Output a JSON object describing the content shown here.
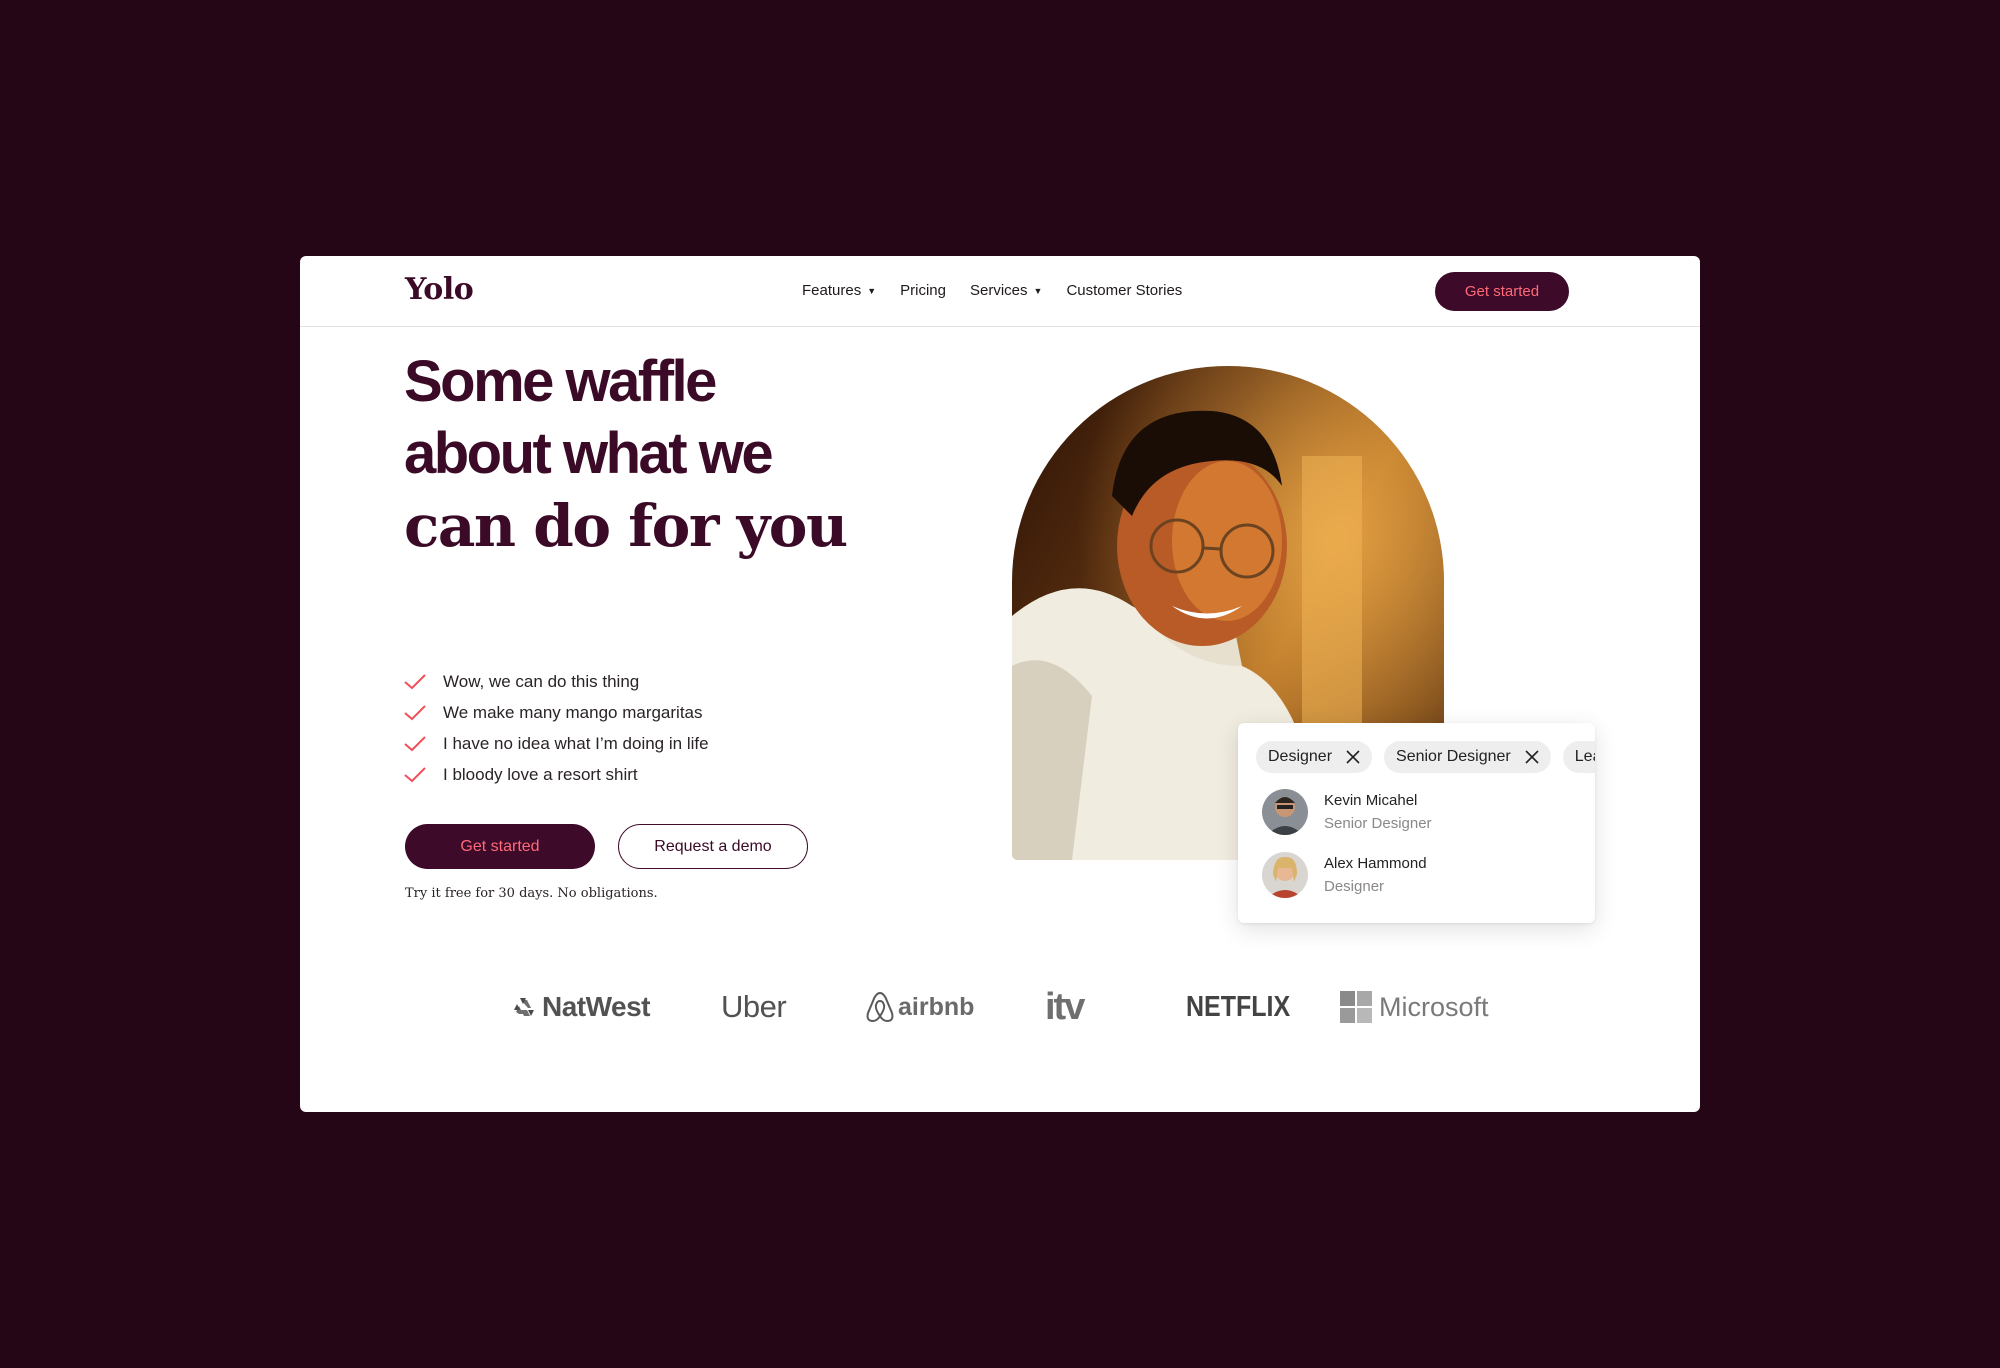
{
  "nav": {
    "logo": "Yolo",
    "links": [
      {
        "label": "Features",
        "has_dropdown": true
      },
      {
        "label": "Pricing",
        "has_dropdown": false
      },
      {
        "label": "Services",
        "has_dropdown": true
      },
      {
        "label": "Customer Stories",
        "has_dropdown": false
      }
    ],
    "cta": "Get started"
  },
  "hero": {
    "headline_bold_1": "Some waffle",
    "headline_bold_2": "about what we",
    "headline_serif": "can do for you",
    "checklist": [
      "Wow, we can do this thing",
      "We make many mango margaritas",
      "I have no idea what I’m doing in life",
      "I bloody love a resort shirt"
    ],
    "primary_button": "Get started",
    "secondary_button": "Request a demo",
    "fine_print": "Try it free for 30 days. No obligations."
  },
  "card": {
    "chips": [
      "Designer",
      "Senior Designer",
      "Lea"
    ],
    "people": [
      {
        "name": "Kevin Micahel",
        "role": "Senior Designer"
      },
      {
        "name": "Alex Hammond",
        "role": "Designer"
      }
    ]
  },
  "logos": {
    "natwest": "NatWest",
    "uber": "Uber",
    "airbnb": "airbnb",
    "itv": "itv",
    "netflix": "NETFLIX",
    "microsoft": "Microsoft"
  },
  "colors": {
    "background": "#240617",
    "brand_dark": "#3d0a29",
    "accent": "#ff6a78",
    "check": "#f0505a"
  },
  "icons": [
    "chevron-down-icon",
    "check-icon",
    "close-icon",
    "natwest-icon",
    "airbnb-icon",
    "microsoft-icon"
  ]
}
